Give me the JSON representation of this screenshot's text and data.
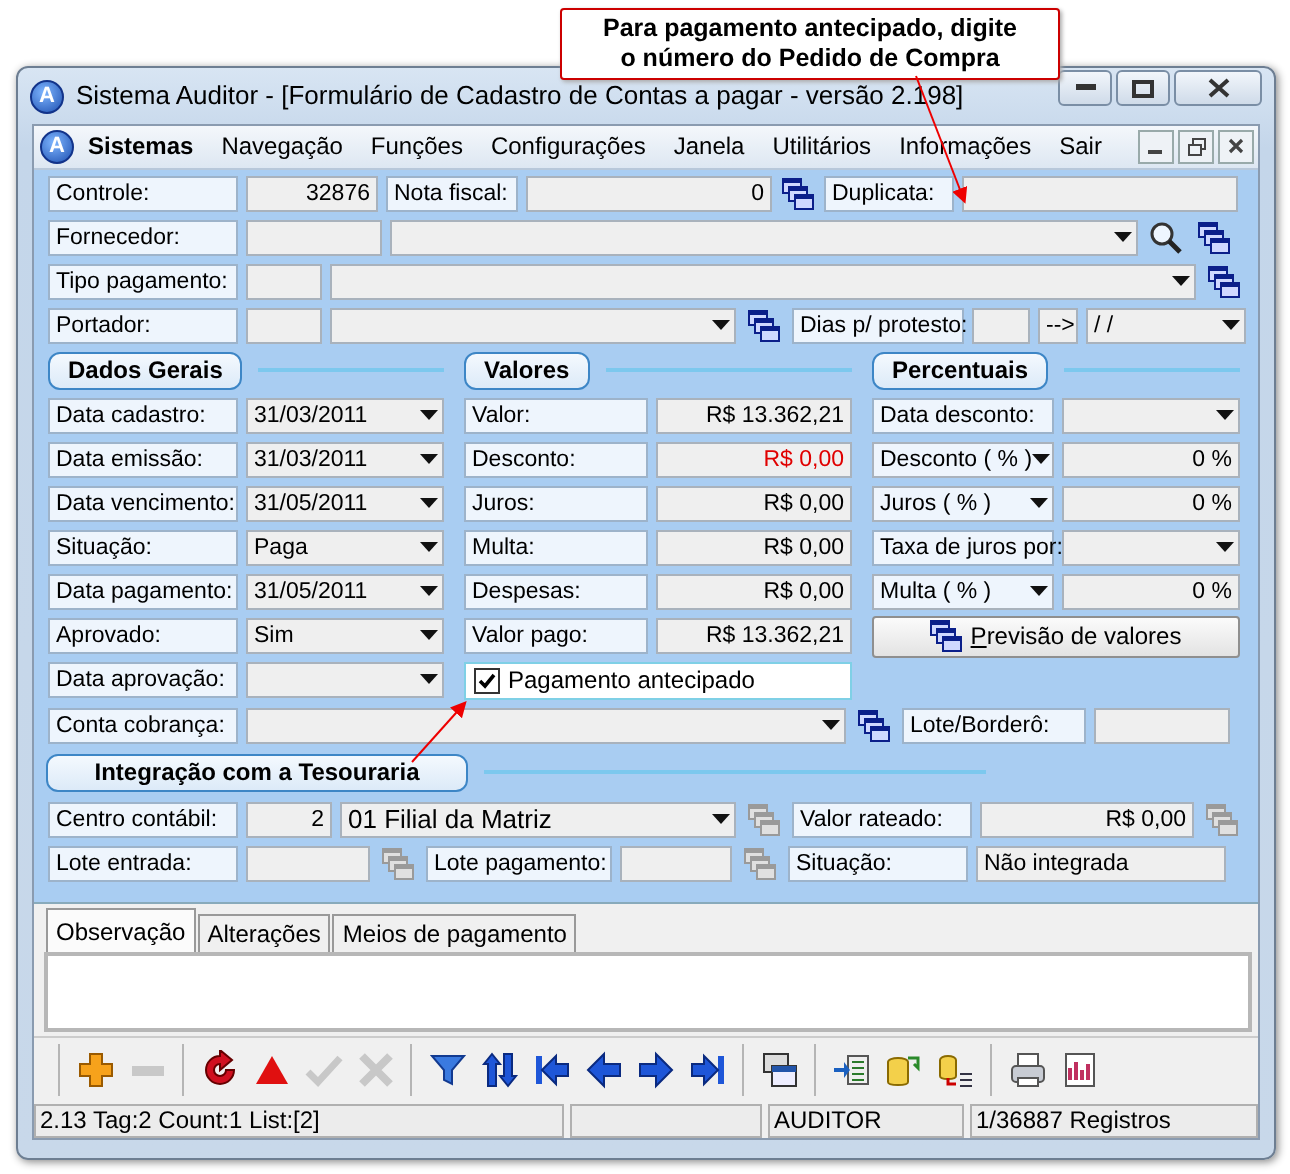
{
  "callout": {
    "lines": [
      "Para pagamento antecipado, digite",
      "o número do Pedido de Compra"
    ]
  },
  "window": {
    "icon_text": "A",
    "title": "Sistema Auditor - [Formulário de Cadastro de Contas a pagar - versão 2.198]"
  },
  "menu": {
    "icon_text": "A",
    "items": [
      "Sistemas",
      "Navegação",
      "Funções",
      "Configurações",
      "Janela",
      "Utilitários",
      "Informações",
      "Sair"
    ]
  },
  "header": {
    "controle": {
      "label": "Controle:",
      "value": "32876"
    },
    "nota_fiscal": {
      "label": "Nota fiscal:",
      "value": "0",
      "button": {
        "disabled": false
      }
    },
    "duplicata": {
      "label": "Duplicata:"
    },
    "fornecedor": {
      "label": "Fornecedor:",
      "button": {
        "disabled": false
      }
    },
    "tipo_pagamento": {
      "label": "Tipo pagamento:",
      "button": {
        "disabled": false
      }
    },
    "portador": {
      "label": "Portador:",
      "button": {
        "disabled": false
      }
    },
    "dias_protesto": {
      "label": "Dias p/ protesto:",
      "arrow": "-->",
      "date": " / /"
    }
  },
  "sections": [
    "Dados Gerais",
    "Valores",
    "Percentuais"
  ],
  "dados_gerais": [
    {
      "label": "Data cadastro:",
      "value": "31/03/2011"
    },
    {
      "label": "Data emissão:",
      "value": "31/03/2011"
    },
    {
      "label": "Data vencimento:",
      "value": "31/05/2011"
    },
    {
      "label": "Situação:",
      "value": "Paga"
    },
    {
      "label": "Data pagamento:",
      "value": "31/05/2011"
    },
    {
      "label": "Aprovado:",
      "value": "Sim"
    },
    {
      "label": "Data aprovação:"
    }
  ],
  "valores": [
    {
      "label": "Valor:",
      "value": "R$ 13.362,21"
    },
    {
      "label": "Desconto:",
      "value": "R$ 0,00",
      "color": "#e00000"
    },
    {
      "label": "Juros:",
      "value": "R$ 0,00"
    },
    {
      "label": "Multa:",
      "value": "R$ 0,00"
    },
    {
      "label": "Despesas:",
      "value": "R$ 0,00"
    },
    {
      "label": "Valor pago:",
      "value": "R$ 13.362,21"
    }
  ],
  "percentuais": [
    {
      "kind": "select-value",
      "label": "Data desconto:"
    },
    {
      "kind": "select-label",
      "label": "Desconto ( % )",
      "value": "0 %"
    },
    {
      "kind": "select-label",
      "label": "Juros ( % )",
      "value": "0 %"
    },
    {
      "kind": "select-value",
      "label": "Taxa de juros por:"
    },
    {
      "kind": "select-label",
      "label": "Multa ( % )",
      "value": "0 %"
    }
  ],
  "previsao_button": {
    "label": "Previsão de valores"
  },
  "pagamento_antecipado": {
    "label": "Pagamento antecipado",
    "checked": true
  },
  "conta_cobranca": {
    "label": "Conta cobrança:",
    "button": {
      "disabled": false
    }
  },
  "lote_bordero": {
    "label": "Lote/Borderô:"
  },
  "tesouraria": {
    "title": "Integração com a Tesouraria",
    "centro_contabil": {
      "label": "Centro contábil:",
      "code": "2",
      "value": "01  Filial da Matriz",
      "button": {
        "disabled": true
      }
    },
    "valor_rateado": {
      "label": "Valor rateado:",
      "value": "R$ 0,00",
      "button": {
        "disabled": true
      }
    },
    "lote_entrada": {
      "label": "Lote entrada:",
      "button": {
        "disabled": true
      }
    },
    "lote_pagamento": {
      "label": "Lote pagamento:",
      "button": {
        "disabled": true
      }
    },
    "situacao": {
      "label": "Situação:",
      "value": "Não integrada"
    }
  },
  "tabs": [
    {
      "label": "Observação",
      "selected": true
    },
    {
      "label": "Alterações",
      "selected": false
    },
    {
      "label": "Meios de pagamento",
      "selected": false
    }
  ],
  "toolbar": [
    [
      {
        "kind": "add",
        "disabled": false
      },
      {
        "kind": "remove",
        "disabled": true
      }
    ],
    [
      {
        "kind": "refresh",
        "disabled": false
      },
      {
        "kind": "triangle",
        "disabled": false
      },
      {
        "kind": "confirm",
        "disabled": true
      },
      {
        "kind": "cancel",
        "disabled": true
      }
    ],
    [
      {
        "kind": "filter",
        "disabled": false
      },
      {
        "kind": "sort",
        "disabled": false
      },
      {
        "kind": "first",
        "disabled": false
      },
      {
        "kind": "prev",
        "disabled": false
      },
      {
        "kind": "next",
        "disabled": false
      },
      {
        "kind": "last",
        "disabled": false
      }
    ],
    [
      {
        "kind": "windows",
        "disabled": false
      }
    ],
    [
      {
        "kind": "import",
        "disabled": false
      },
      {
        "kind": "transfer",
        "disabled": false
      },
      {
        "kind": "export",
        "disabled": false
      }
    ],
    [
      {
        "kind": "print",
        "disabled": false
      },
      {
        "kind": "chart",
        "disabled": false
      }
    ]
  ],
  "status_bar": {
    "info": "2.13 Tag:2 Count:1 List:[2]",
    "user": "AUDITOR",
    "records": "1/36887 Registros"
  }
}
